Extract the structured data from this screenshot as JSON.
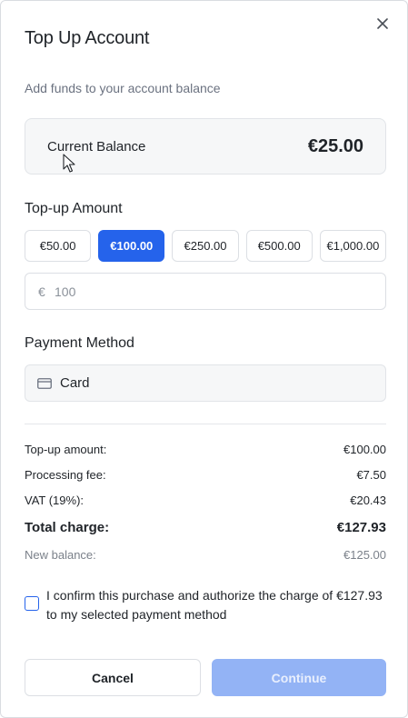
{
  "dialog": {
    "title": "Top Up Account",
    "subtitle": "Add funds to your account balance",
    "close_icon": "close-icon"
  },
  "balance": {
    "label": "Current Balance",
    "value": "€25.00"
  },
  "topup": {
    "label": "Top-up Amount",
    "amounts": [
      "€50.00",
      "€100.00",
      "€250.00",
      "€500.00",
      "€1,000.00"
    ],
    "selected": "€100.00",
    "currency_symbol": "€",
    "input_value": "",
    "input_placeholder": "100"
  },
  "payment": {
    "label": "Payment Method",
    "selected": "Card",
    "icon": "credit-card-icon"
  },
  "summary": {
    "topup_label": "Top-up amount:",
    "topup_value": "€100.00",
    "fee_label": "Processing fee:",
    "fee_value": "€7.50",
    "vat_label": "VAT (19%):",
    "vat_value": "€20.43",
    "total_label": "Total charge:",
    "total_value": "€127.93",
    "new_balance_label": "New balance:",
    "new_balance_value": "€125.00"
  },
  "confirm": {
    "text": "I confirm this purchase and authorize the charge of €127.93 to my selected payment method",
    "checked": false
  },
  "actions": {
    "cancel_label": "Cancel",
    "continue_label": "Continue"
  },
  "colors": {
    "accent": "#2563eb",
    "continue_disabled": "#93b3f5"
  }
}
